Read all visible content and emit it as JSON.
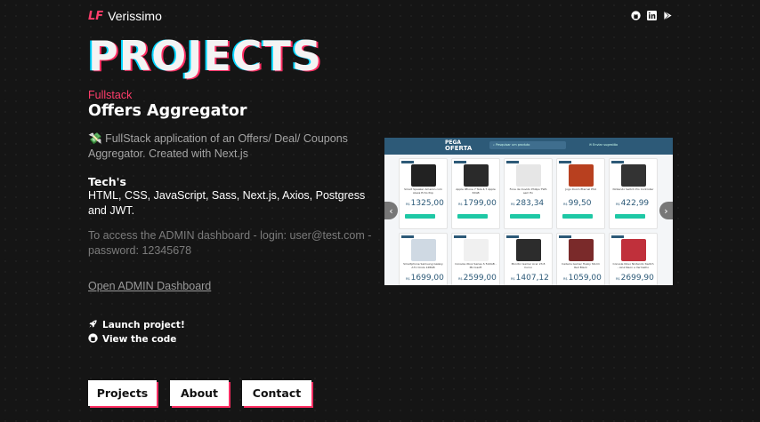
{
  "header": {
    "brand_mark": "LF",
    "brand_name": "Verissimo",
    "social_icons": [
      "github-icon",
      "linkedin-icon",
      "google-play-icon"
    ]
  },
  "page": {
    "title": "PROJECTS"
  },
  "project": {
    "kicker": "Fullstack",
    "title": "Offers Aggregator",
    "emoji": "💸",
    "description": "FullStack application of an Offers/ Deal/ Coupons Aggregator. Created with Next.js",
    "techs_heading": "Tech's",
    "techs": "HTML, CSS, JavaScript, Sass, Next.js, Axios, Postgress and JWT.",
    "admin_note": "To access the ADMIN dashboard - login: user@test.com - password: 12345678",
    "admin_link": "Open ADMIN Dashboard",
    "launch_label": "Launch project!",
    "code_label": "View the code"
  },
  "nav": {
    "projects": "Projects",
    "about": "About",
    "contact": "Contact"
  },
  "colors": {
    "accent": "#ff2e63",
    "cyan": "#00d5ff",
    "background": "#151515"
  },
  "preview": {
    "logo_top": "PEGA",
    "logo_bottom": "OFERTA",
    "search_placeholder": "Pesquisar um produto",
    "side_link": "Enviar sugestão",
    "products": [
      {
        "name": "Smart Speaker Amazon com Alexa Echo Pop",
        "price": "1325,00",
        "color": "#222222"
      },
      {
        "name": "Apple iPhone 7 Tela 4,7 Apple 32GB",
        "price": "1799,00",
        "color": "#2a2a2a"
      },
      {
        "name": "Fone de Ouvido Philips TWS sem fio",
        "price": "283,34",
        "color": "#e6e6e6"
      },
      {
        "name": "Jogo Doom Eternal PS4",
        "price": "99,50",
        "color": "#b8401f"
      },
      {
        "name": "Nintendo Switch Pro Controller",
        "price": "422,99",
        "color": "#333333"
      },
      {
        "name": "Smartphone Samsung Galaxy A71 Cinza 128GB",
        "price": "1699,00",
        "color": "#cfd9e3"
      },
      {
        "name": "Console Xbox Series S 512GB - Microsoft",
        "price": "2599,00",
        "color": "#f0f0f0"
      },
      {
        "name": "Monitor Gamer Acer 23.8 Curvo",
        "price": "1407,12",
        "color": "#2c2c2c"
      },
      {
        "name": "Cadeira Gamer Husky Storm Red Black",
        "price": "1059,00",
        "color": "#7a2a2a"
      },
      {
        "name": "Console Novo Nintendo Switch - Azul Neon e Vermelho",
        "price": "2699,90",
        "color": "#c0303b"
      }
    ]
  }
}
